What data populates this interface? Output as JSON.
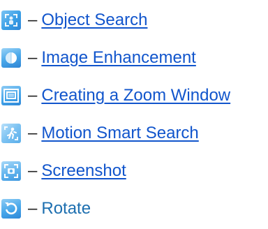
{
  "legend": {
    "separator": "–",
    "items": [
      {
        "icon": "object-search-icon",
        "label": "Object Search",
        "link": true
      },
      {
        "icon": "image-enhancement-icon",
        "label": "Image Enhancement",
        "link": true
      },
      {
        "icon": "zoom-window-icon",
        "label": "Creating a Zoom Window",
        "link": true
      },
      {
        "icon": "motion-smart-search-icon",
        "label": "Motion Smart Search",
        "link": true
      },
      {
        "icon": "screenshot-icon",
        "label": "Screenshot",
        "link": true
      },
      {
        "icon": "rotate-icon",
        "label": "Rotate",
        "link": false
      }
    ]
  },
  "colors": {
    "link": "#1155cc",
    "plain": "#1d6fb0",
    "icon_blue": "#3a9fe6",
    "icon_light": "#8ec9f2"
  }
}
